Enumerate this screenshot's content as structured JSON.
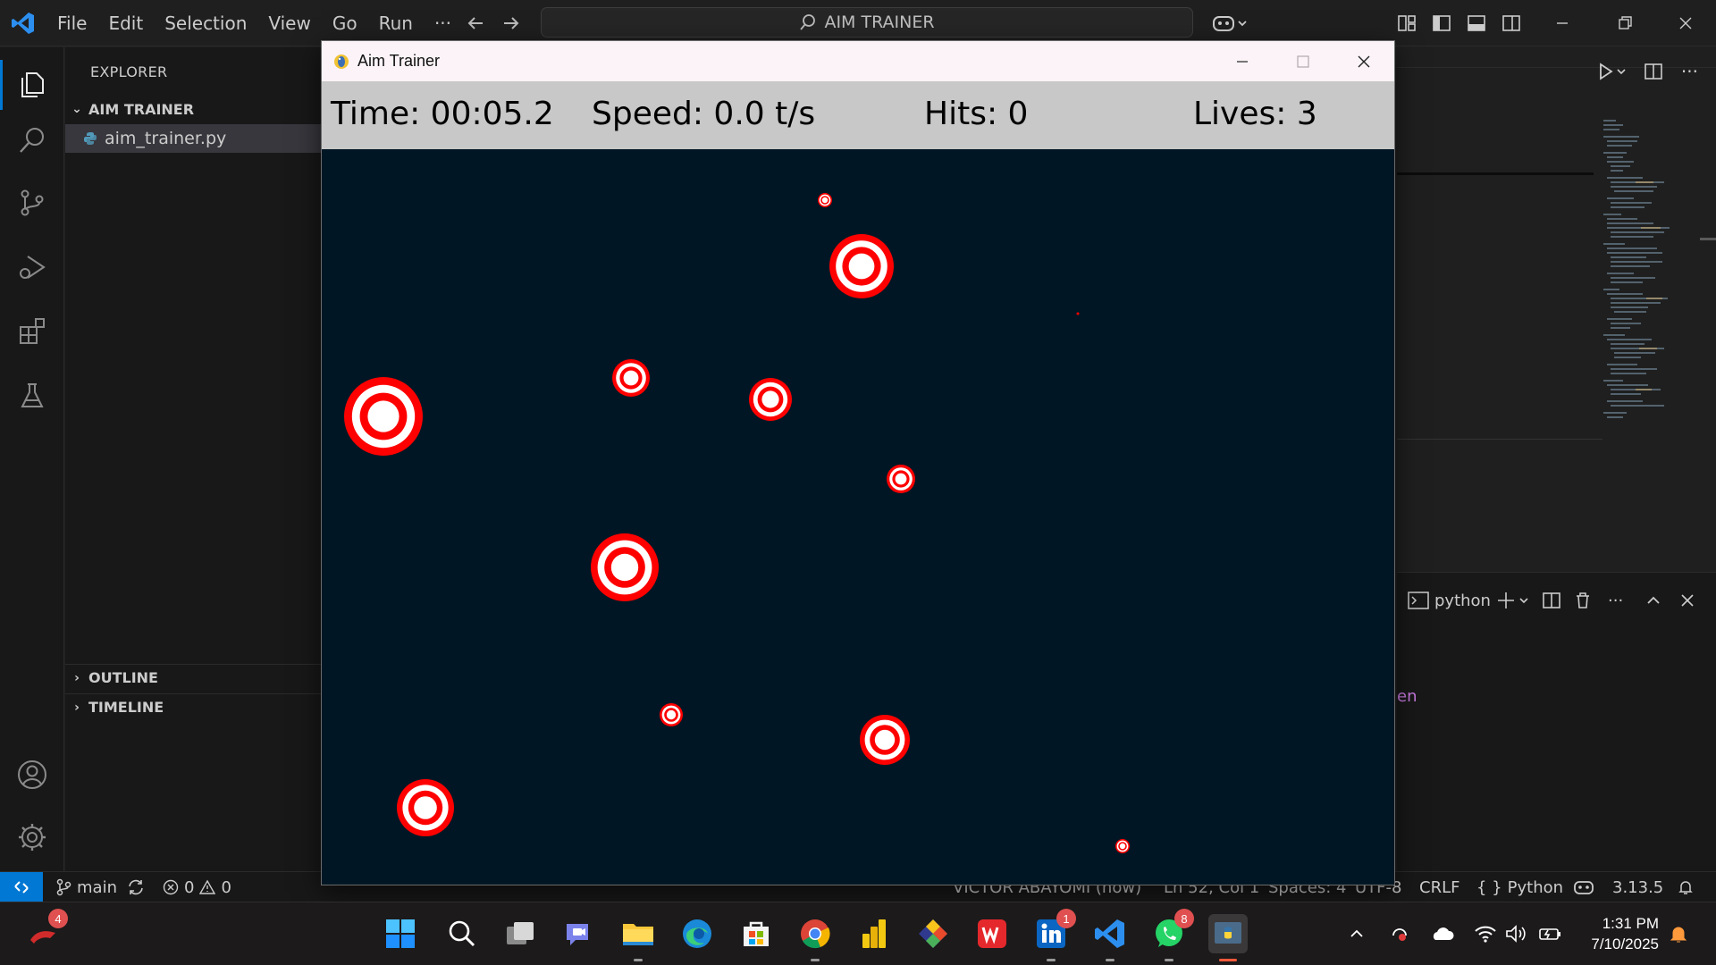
{
  "vscode": {
    "menu": [
      "File",
      "Edit",
      "Selection",
      "View",
      "Go",
      "Run"
    ],
    "more_label": "···",
    "search_text": "AIM TRAINER",
    "explorer_title": "EXPLORER",
    "folder_name": "AIM TRAINER",
    "file_name": "aim_trainer.py",
    "outline_label": "OUTLINE",
    "timeline_label": "TIMELINE",
    "terminal_name": "python",
    "partial_terminal_text": "en",
    "accent_color": "#0078d4"
  },
  "statusbar": {
    "branch": "main",
    "errors": "0",
    "warnings": "0",
    "author": "VICTOR ABAYOMI (now)",
    "cursor": "Ln 52, Col 1",
    "spaces": "Spaces: 4",
    "encoding": "UTF-8",
    "eol": "CRLF",
    "language": "Python",
    "python_version": "3.13.5"
  },
  "game": {
    "window_title": "Aim Trainer",
    "hud": {
      "time": "Time: 00:05.2",
      "speed": "Speed: 0.0 t/s",
      "hits": "Hits: 0",
      "lives": "Lives: 3"
    },
    "background_color": "#001624",
    "target_colors": {
      "outer": "#ff0000",
      "ring": "#ffffff"
    }
  },
  "taskbar": {
    "apps": [
      "start",
      "search",
      "task-view",
      "teams",
      "file-explorer",
      "edge",
      "microsoft-store",
      "chrome",
      "power-bi",
      "git-tool",
      "wps-office",
      "linkedin",
      "vscode",
      "whatsapp",
      "python"
    ],
    "badges": {
      "left": "4",
      "linkedin": "1",
      "whatsapp": "8"
    },
    "time": "1:31 PM",
    "date": "7/10/2025"
  }
}
